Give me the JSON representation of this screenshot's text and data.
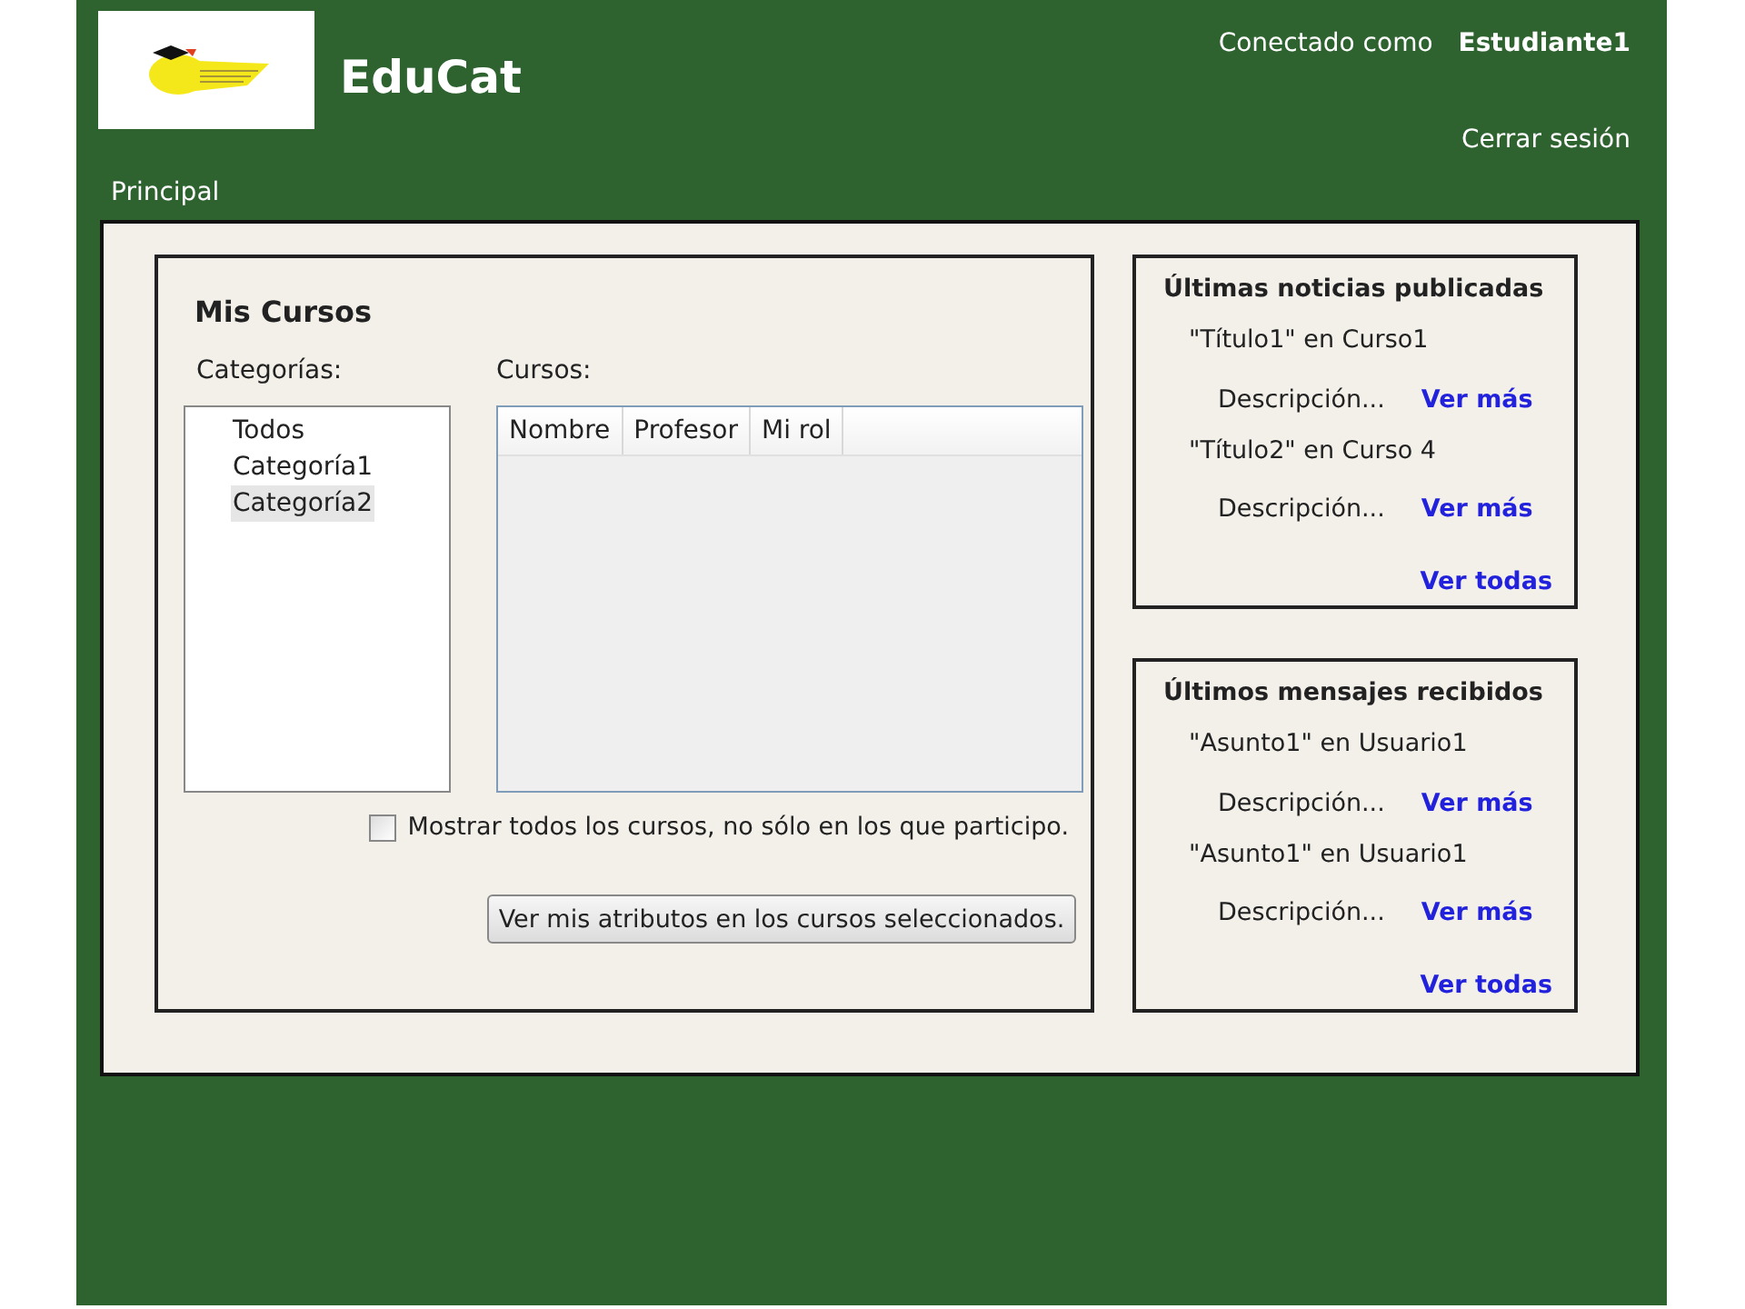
{
  "header": {
    "title": "EduCat",
    "connected_label": "Conectado como",
    "user": "Estudiante1",
    "logout": "Cerrar sesión"
  },
  "nav": {
    "items": [
      {
        "label": "Principal"
      }
    ]
  },
  "courses": {
    "title": "Mis Cursos",
    "categories_label": "Categorías:",
    "courses_label": "Cursos:",
    "categories": [
      {
        "label": "Todos",
        "selected": false
      },
      {
        "label": "Categoría1",
        "selected": false
      },
      {
        "label": "Categoría2",
        "selected": true
      }
    ],
    "columns": [
      "Nombre",
      "Profesor",
      "Mi rol"
    ],
    "show_all": {
      "label": "Mostrar todos los cursos, no sólo en los que participo.",
      "checked": false
    },
    "button": "Ver mis atributos en los cursos seleccionados."
  },
  "panels": [
    {
      "title": "Últimas noticias publicadas",
      "items": [
        {
          "heading": "\"Título1\" en Curso1",
          "description": "Descripción...",
          "link": "Ver más"
        },
        {
          "heading": "\"Título2\" en Curso 4",
          "description": "Descripción...",
          "link": "Ver más"
        }
      ],
      "all_link": "Ver todas"
    },
    {
      "title": "Últimos mensajes recibidos",
      "items": [
        {
          "heading": "\"Asunto1\" en Usuario1",
          "description": "Descripción...",
          "link": "Ver más"
        },
        {
          "heading": "\"Asunto1\" en Usuario1",
          "description": "Descripción...",
          "link": "Ver más"
        }
      ],
      "all_link": "Ver todas"
    }
  ]
}
